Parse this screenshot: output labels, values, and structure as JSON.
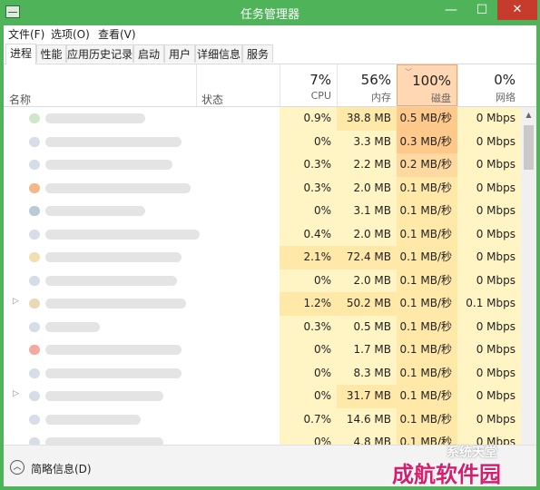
{
  "window": {
    "title": "任务管理器",
    "min_label": "—",
    "max_label": "☐",
    "close_label": "✕"
  },
  "menu": [
    {
      "label": "文件(F)"
    },
    {
      "label": "选项(O)"
    },
    {
      "label": "查看(V)"
    }
  ],
  "tabs": [
    {
      "label": "进程",
      "active": true
    },
    {
      "label": "性能"
    },
    {
      "label": "应用历史记录"
    },
    {
      "label": "启动"
    },
    {
      "label": "用户"
    },
    {
      "label": "详细信息"
    },
    {
      "label": "服务"
    }
  ],
  "header": {
    "name": "名称",
    "status": "状态",
    "cpu": {
      "pct": "7%",
      "label": "CPU"
    },
    "memory": {
      "pct": "56%",
      "label": "内存"
    },
    "disk": {
      "pct": "100%",
      "label": "磁盘"
    },
    "network": {
      "pct": "0%",
      "label": "网络"
    }
  },
  "rows": [
    {
      "cpu": "0.9%",
      "mem": "38.8 MB",
      "disk": "0.5 MB/秒",
      "net": "0 Mbps"
    },
    {
      "cpu": "0%",
      "mem": "3.3 MB",
      "disk": "0.3 MB/秒",
      "net": "0 Mbps"
    },
    {
      "cpu": "0.3%",
      "mem": "2.2 MB",
      "disk": "0.2 MB/秒",
      "net": "0 Mbps"
    },
    {
      "cpu": "0.3%",
      "mem": "2.0 MB",
      "disk": "0.1 MB/秒",
      "net": "0 Mbps"
    },
    {
      "cpu": "0%",
      "mem": "3.1 MB",
      "disk": "0.1 MB/秒",
      "net": "0 Mbps"
    },
    {
      "cpu": "0.4%",
      "mem": "2.0 MB",
      "disk": "0.1 MB/秒",
      "net": "0 Mbps"
    },
    {
      "cpu": "2.1%",
      "mem": "72.4 MB",
      "disk": "0.1 MB/秒",
      "net": "0 Mbps"
    },
    {
      "cpu": "0%",
      "mem": "2.0 MB",
      "disk": "0.1 MB/秒",
      "net": "0 Mbps"
    },
    {
      "cpu": "1.2%",
      "mem": "50.2 MB",
      "disk": "0.1 MB/秒",
      "net": "0.1 Mbps"
    },
    {
      "cpu": "0.3%",
      "mem": "0.5 MB",
      "disk": "0.1 MB/秒",
      "net": "0 Mbps"
    },
    {
      "cpu": "0%",
      "mem": "1.7 MB",
      "disk": "0.1 MB/秒",
      "net": "0 Mbps"
    },
    {
      "cpu": "0%",
      "mem": "8.3 MB",
      "disk": "0.1 MB/秒",
      "net": "0 Mbps"
    },
    {
      "cpu": "0%",
      "mem": "31.7 MB",
      "disk": "0.1 MB/秒",
      "net": "0 Mbps"
    },
    {
      "cpu": "0.7%",
      "mem": "14.6 MB",
      "disk": "0.1 MB/秒",
      "net": "0 Mbps"
    },
    {
      "cpu": "0%",
      "mem": "4.8 MB",
      "disk": "0.1 MB/秒",
      "net": "0 Mbps"
    }
  ],
  "footer": {
    "fewer_details": "简略信息(D)"
  },
  "watermark": {
    "top": "系统天堂",
    "main": "成航软件园"
  },
  "colors": {
    "titlebar": "#4fb35a",
    "close": "#c73b2c",
    "disk_header": "#ffd7b3",
    "cell_low": "#fff4c4",
    "cell_mid": "#ffe8a8",
    "disk_high": "#ffc98c"
  }
}
